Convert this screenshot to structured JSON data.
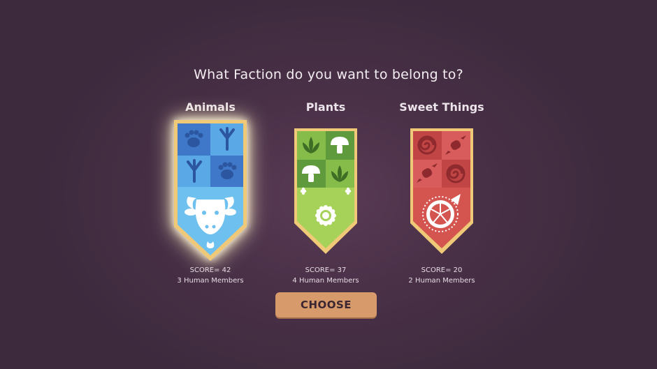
{
  "prompt": "What Faction do you want to belong to?",
  "factions": [
    {
      "name": "Animals",
      "score": "SCORE= 42",
      "members": "3 Human Members",
      "selected": true,
      "icons": [
        "paw-icon",
        "bird-track-icon",
        "bird-track-icon",
        "paw-icon",
        "bull-head-icon"
      ],
      "colors": {
        "top_dark": "#3f78c8",
        "top_light": "#5aa8e6",
        "bottom": "#6ec0ef",
        "border": "#f0c978"
      }
    },
    {
      "name": "Plants",
      "score": "SCORE= 37",
      "members": "4 Human Members",
      "selected": false,
      "icons": [
        "lotus-icon",
        "mushroom-icon",
        "mushroom-icon",
        "lotus-icon",
        "flower-icon"
      ],
      "colors": {
        "top_dark": "#5f9a3d",
        "top_light": "#86bd4a",
        "bottom": "#a7d25a",
        "border": "#f0c978"
      }
    },
    {
      "name": "Sweet Things",
      "score": "SCORE= 20",
      "members": "2 Human Members",
      "selected": false,
      "icons": [
        "spiral-candy-icon",
        "wrapped-candy-icon",
        "wrapped-candy-icon",
        "spiral-candy-icon",
        "pie-icon"
      ],
      "colors": {
        "top_dark": "#c24545",
        "top_light": "#d85c5c",
        "bottom": "#d4554f",
        "border": "#f0c978"
      }
    }
  ],
  "choose_label": "CHOOSE"
}
